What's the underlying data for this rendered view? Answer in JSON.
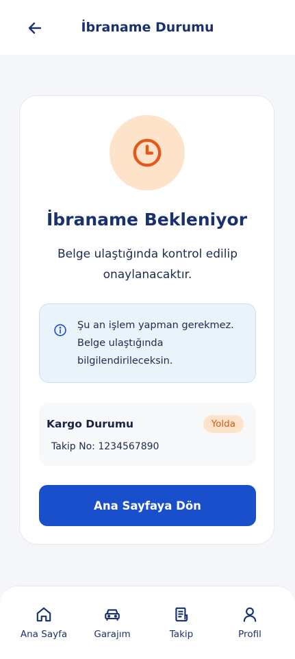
{
  "header": {
    "title": "İbraname Durumu",
    "back_icon": "arrow-left-icon"
  },
  "status_card": {
    "icon": "clock-icon",
    "icon_color": "#e8571a",
    "icon_bg": "#fde3c9",
    "title": "İbraname Bekleniyor",
    "subtitle": "Belge ulaştığında kontrol edilip onaylanacaktır.",
    "info": {
      "icon": "info-icon",
      "text": "Şu an işlem yapman gerekmez. Belge ulaştığında bilgilendirileceksin."
    },
    "cargo": {
      "title": "Kargo Durumu",
      "badge": "Yolda",
      "tracking": "Takip No: 1234567890"
    },
    "button_label": "Ana Sayfaya Dön"
  },
  "bottom_nav": {
    "items": [
      {
        "label": "Ana Sayfa",
        "icon": "home-icon"
      },
      {
        "label": "Garajım",
        "icon": "car-icon"
      },
      {
        "label": "Takip",
        "icon": "document-icon"
      },
      {
        "label": "Profil",
        "icon": "user-icon"
      }
    ]
  },
  "colors": {
    "primary": "#1a4fcb",
    "title_text": "#1a3170",
    "badge_text": "#d45a12",
    "info_bg": "#eaf3fc"
  }
}
